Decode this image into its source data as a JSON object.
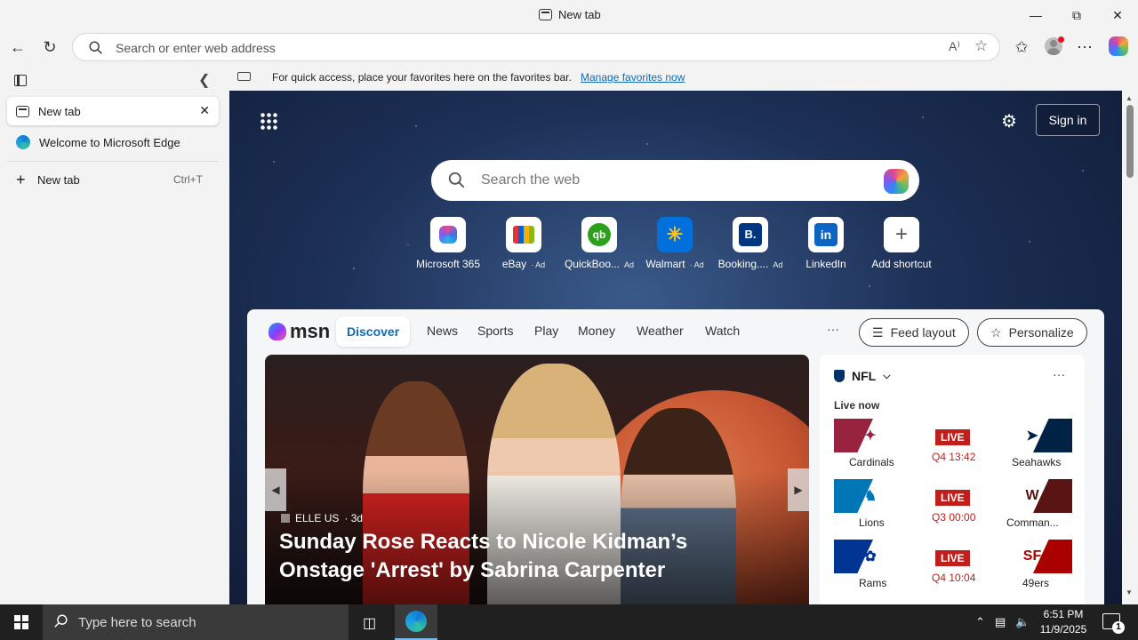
{
  "window": {
    "title": "New tab",
    "controls": [
      "minimize-icon",
      "restore-icon",
      "close-icon"
    ]
  },
  "toolbar": {
    "address_placeholder": "Search or enter web address",
    "read_aloud_label": "A⁾"
  },
  "sidebar": {
    "tabs": [
      {
        "label": "New tab",
        "active": true
      },
      {
        "label": "Welcome to Microsoft Edge",
        "active": false
      }
    ],
    "new_tab": {
      "label": "New tab",
      "shortcut": "Ctrl+T"
    }
  },
  "favorites_bar": {
    "message": "For quick access, place your favorites here on the favorites bar.",
    "link": "Manage favorites now"
  },
  "newtab": {
    "sign_in": "Sign in",
    "search_placeholder": "Search the web",
    "shortcuts": [
      {
        "label": "Microsoft 365",
        "ad": "",
        "icon": "microsoft-365-icon"
      },
      {
        "label": "eBay",
        "ad": "· Ad",
        "icon": "ebay-icon"
      },
      {
        "label": "QuickBoo...",
        "ad": "Ad",
        "icon": "quickbooks-icon"
      },
      {
        "label": "Walmart",
        "ad": "· Ad",
        "icon": "walmart-icon"
      },
      {
        "label": "Booking....",
        "ad": "Ad",
        "icon": "booking-icon"
      },
      {
        "label": "LinkedIn",
        "ad": "",
        "icon": "linkedin-icon"
      },
      {
        "label": "Add shortcut",
        "ad": "",
        "icon": "plus-icon"
      }
    ]
  },
  "feed": {
    "logo_text": "msn",
    "tabs": [
      "Discover",
      "News",
      "Sports",
      "Play",
      "Money",
      "Weather",
      "Watch"
    ],
    "more": "···",
    "feed_layout": "Feed layout",
    "personalize": "Personalize",
    "hero": {
      "source": "ELLE US",
      "age": "· 3d",
      "headline": "Sunday Rose Reacts to Nicole Kidman’s Onstage 'Arrest' by Sabrina Carpenter"
    },
    "nfl": {
      "title": "NFL",
      "live_now": "Live now",
      "games": [
        {
          "home": "Cardinals",
          "away": "Seahawks",
          "status": "LIVE",
          "clock": "Q4 13:42",
          "home_color": "#97233f",
          "away_color": "#002244"
        },
        {
          "home": "Lions",
          "away": "Comman...",
          "status": "LIVE",
          "clock": "Q3 00:00",
          "home_color": "#0076b6",
          "away_color": "#5a1414"
        },
        {
          "home": "Rams",
          "away": "49ers",
          "status": "LIVE",
          "clock": "Q4 10:04",
          "home_color": "#003594",
          "away_color": "#aa0000"
        }
      ]
    }
  },
  "taskbar": {
    "search_placeholder": "Type here to search",
    "time": "6:51 PM",
    "date": "11/9/2025",
    "notification_count": "1"
  }
}
